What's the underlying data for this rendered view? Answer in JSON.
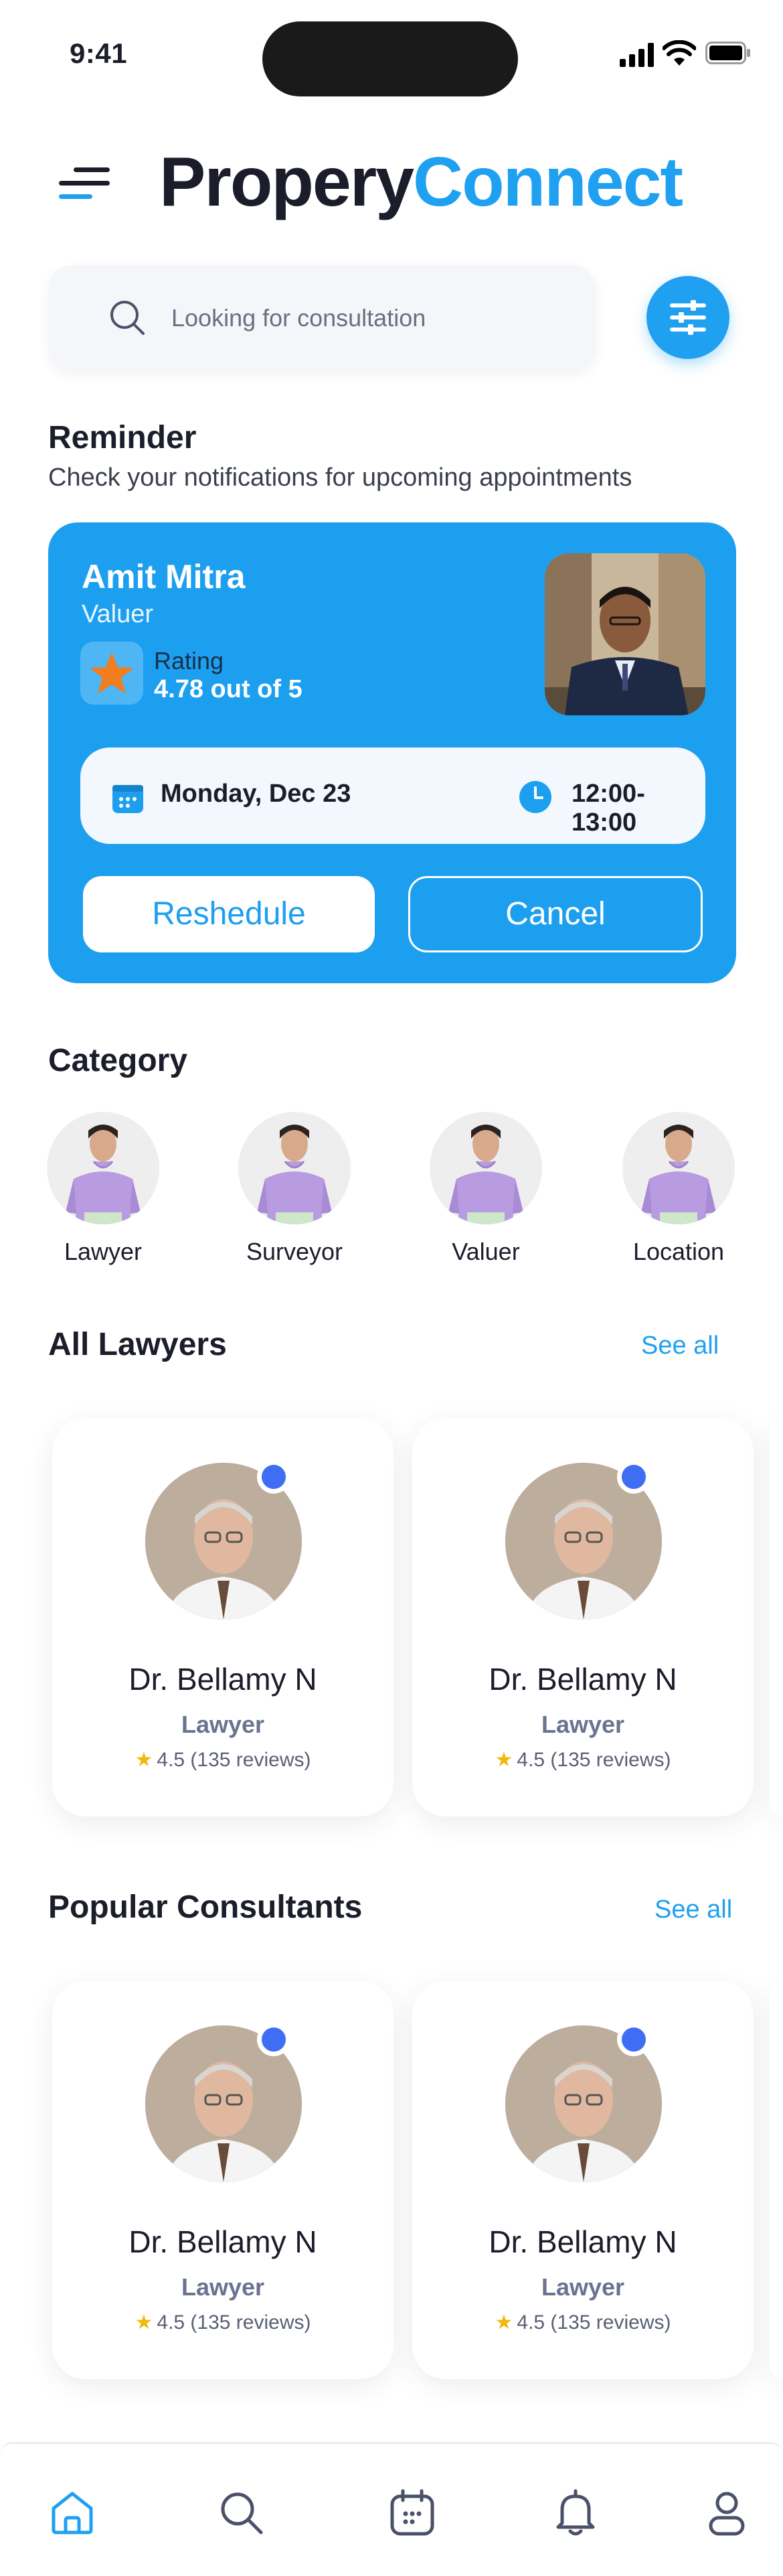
{
  "status_bar": {
    "time": "9:41"
  },
  "header": {
    "brand_part1": "Propery",
    "brand_part2": "Connect"
  },
  "search": {
    "placeholder": "Looking for consultation"
  },
  "reminder": {
    "title": "Reminder",
    "subtitle": "Check your notifications for upcoming appointments",
    "name": "Amit Mitra",
    "role": "Valuer",
    "rating_label": "Rating",
    "rating_value": "4.78 out of 5",
    "date": "Monday, Dec 23",
    "time": "12:00-13:00",
    "reschedule_label": "Reshedule",
    "cancel_label": "Cancel"
  },
  "category": {
    "title": "Category",
    "items": [
      {
        "label": "Lawyer"
      },
      {
        "label": "Surveyor"
      },
      {
        "label": "Valuer"
      },
      {
        "label": "Location"
      }
    ]
  },
  "all_lawyers": {
    "title": "All Lawyers",
    "see_all": "See all",
    "cards": [
      {
        "name": "Dr. Bellamy N",
        "role": "Lawyer",
        "rating": "4.5 (135 reviews)"
      },
      {
        "name": "Dr. Bellamy N",
        "role": "Lawyer",
        "rating": "4.5 (135 reviews)"
      }
    ]
  },
  "popular": {
    "title": "Popular Consultants",
    "see_all": "See all",
    "cards": [
      {
        "name": "Dr. Bellamy N",
        "role": "Lawyer",
        "rating": "4.5 (135 reviews)"
      },
      {
        "name": "Dr. Bellamy N",
        "role": "Lawyer",
        "rating": "4.5 (135 reviews)"
      }
    ]
  },
  "nav": {
    "items": [
      "home-icon",
      "search-icon",
      "calendar-icon",
      "bell-icon",
      "profile-icon"
    ],
    "active": "home-icon"
  },
  "colors": {
    "accent": "#1fa0f0",
    "card_blue": "#1d9ff0",
    "online_dot": "#3f6ef5",
    "star": "#f2b90d",
    "text_dark": "#1b1d2b"
  }
}
